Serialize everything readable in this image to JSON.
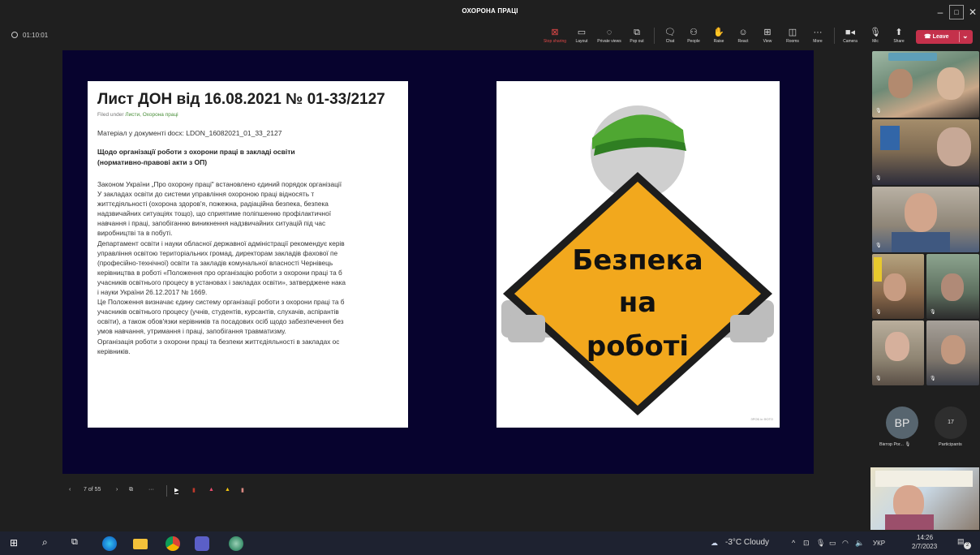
{
  "window": {
    "title": "ОХОРОНА ПРАЦІ"
  },
  "toolbar": {
    "timer": "01:10:01",
    "items": [
      {
        "label": "Stop sharing",
        "icon": "stop-sharing-icon"
      },
      {
        "label": "Layout",
        "icon": "layout-icon"
      },
      {
        "label": "Private views",
        "icon": "private-views-icon"
      },
      {
        "label": "Pop out",
        "icon": "pop-out-icon"
      },
      {
        "label": "Chat",
        "icon": "chat-icon"
      },
      {
        "label": "People",
        "icon": "people-icon"
      },
      {
        "label": "Raise",
        "icon": "raise-hand-icon"
      },
      {
        "label": "React",
        "icon": "react-icon"
      },
      {
        "label": "View",
        "icon": "view-icon"
      },
      {
        "label": "Rooms",
        "icon": "rooms-icon"
      },
      {
        "label": "More",
        "icon": "more-icon"
      },
      {
        "label": "Camera",
        "icon": "camera-icon"
      },
      {
        "label": "Mic",
        "icon": "mic-icon"
      },
      {
        "label": "Share",
        "icon": "share-icon"
      }
    ],
    "leave_label": "Leave",
    "accent": "#c4314b"
  },
  "document": {
    "title": "Лист ДОН від 16.08.2021 № 01-33/2127",
    "filed_prefix": "Filed under ",
    "filed_links": "Листи, Охорона праці",
    "material": "Матеріал у документі docx: LDON_16082021_01_33_2127",
    "subheading": "Щодо організації роботи з охорони праці в закладі освіти (нормативно-правові акти з ОП)",
    "lines": [
      "Законом України „Про охорону праці\" встановлено єдиний порядок організації",
      "У закладах освіти до системи управління охороною праці відносять т",
      "життєдіяльності (охорона здоров'я, пожежна, радіаційна безпека, безпека",
      "надзвичайних ситуаціях тощо), що сприятиме поліпшенню профілактичної",
      "навчання і праці, запобіганню виникнення надзвичайних ситуацій під час",
      "виробництві та в побуті.",
      "Департамент освіти і науки обласної державної адміністрації рекомендує керів",
      "управління освітою територіальних громад, директорам закладів фахової пе",
      "(професійно-технічної) освіти та закладів комунальної власності Чернівець",
      "керівництва в роботі «Положення про організацію роботи з охорони праці та б",
      "учасників освітнього процесу в установах і закладах освіти», затверджене нака",
      "і науки України 26.12.2017 № 1669.",
      "Це Положення визначає єдину систему організації роботи з охорони праці та б",
      "учасників освітнього процесу (учнів, студентів, курсантів, слухачів, аспірантів",
      "освіти), а також обов'язки керівників та посадових осіб щодо забезпечення без",
      "умов навчання, утримання і праці, запобігання травматизму.",
      "Організація роботи з охорони праці та безпеки життєдіяльності в закладах ос",
      "керівників."
    ]
  },
  "safety_sign": {
    "line1": "Безпека",
    "line2": "на",
    "line3": "роботі",
    "credit": "ЗРОБ in ФОТО",
    "sign_color": "#f2a81d",
    "cap_color": "#4fa732"
  },
  "slide_nav": {
    "counter": "7 of 55"
  },
  "participants": {
    "avatar_initials": "ВР",
    "avatar_name": "Віктор Рог...",
    "count": "17",
    "count_label": "Participants"
  },
  "taskbar": {
    "weather": "-3°C  Cloudy",
    "lang": "УКР",
    "time": "14:26",
    "date": "2/7/2023",
    "notifications": "2"
  }
}
